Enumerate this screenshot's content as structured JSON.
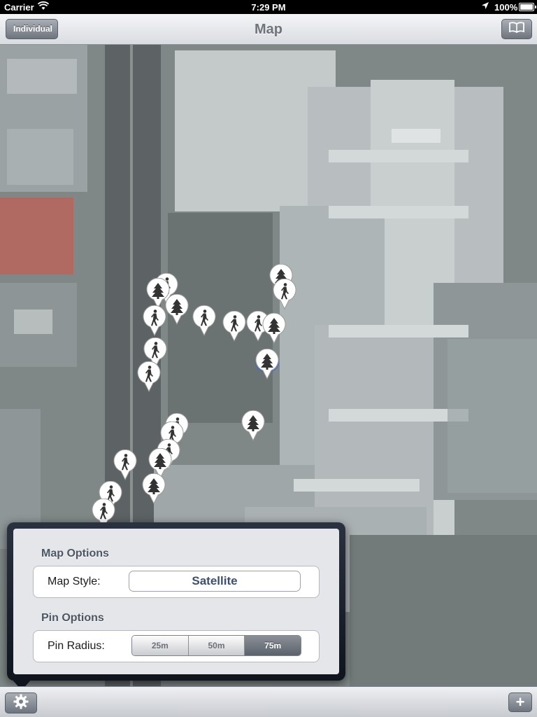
{
  "status_bar": {
    "carrier": "Carrier",
    "time": "7:29 PM",
    "battery": "100%"
  },
  "nav_bar": {
    "title": "Map",
    "back_label": "Individual",
    "right_icon": "book-icon"
  },
  "map": {
    "type": "satellite",
    "pins": [
      {
        "icon": "walker-icon"
      },
      {
        "icon": "tree-icon"
      },
      {
        "icon": "tree-icon"
      },
      {
        "icon": "tree-icon"
      },
      {
        "icon": "walker-icon"
      },
      {
        "icon": "walker-icon"
      },
      {
        "icon": "walker-icon"
      },
      {
        "icon": "walker-icon"
      },
      {
        "icon": "walker-icon"
      },
      {
        "icon": "walker-icon"
      },
      {
        "icon": "tree-icon"
      },
      {
        "icon": "tree-icon"
      },
      {
        "icon": "walker-icon"
      },
      {
        "icon": "tree-icon"
      },
      {
        "icon": "walker-icon"
      },
      {
        "icon": "walker-icon"
      },
      {
        "icon": "walker-icon"
      },
      {
        "icon": "walker-icon"
      },
      {
        "icon": "tree-icon"
      },
      {
        "icon": "tree-icon"
      },
      {
        "icon": "walker-icon"
      },
      {
        "icon": "walker-icon"
      },
      {
        "icon": "walker-icon"
      }
    ]
  },
  "popover": {
    "map_options_title": "Map Options",
    "map_style_label": "Map Style:",
    "map_style_value": "Satellite",
    "pin_options_title": "Pin Options",
    "pin_radius_label": "Pin Radius:",
    "pin_radius_options": [
      "25m",
      "50m",
      "75m"
    ],
    "pin_radius_selected": "75m"
  },
  "toolbar": {
    "left_icon": "gear-icon",
    "right_label": "+"
  },
  "colors": {
    "nav_title": "#70757c",
    "map_style_text": "#3b4f6f",
    "section_title": "#4d5763",
    "popover_frame": "#1b2230"
  }
}
